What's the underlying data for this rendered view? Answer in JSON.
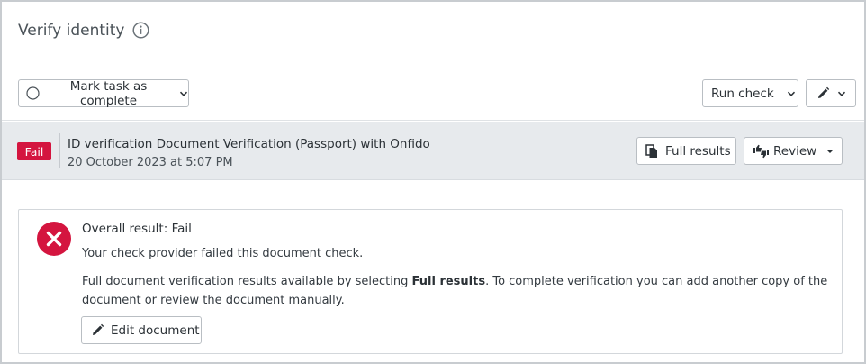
{
  "header": {
    "title": "Verify identity",
    "info_icon": "info-circle-icon"
  },
  "toolbar": {
    "mark_complete_label": "Mark task as complete",
    "run_check_label": "Run check",
    "edit_menu_icon": "pencil-icon"
  },
  "check": {
    "status": "Fail",
    "status_color": "#d4153f",
    "title": "ID verification Document Verification (Passport) with Onfido",
    "date": "20 October 2023 at 5:07 PM",
    "full_results_label": "Full results",
    "review_label": "Review"
  },
  "result": {
    "heading": "Overall result: Fail",
    "message": "Your check provider failed this document check.",
    "detail_prefix": "Full document verification results available by selecting ",
    "detail_bold": "Full results",
    "detail_suffix": ". To complete verification you can add another copy of the document or review the document manually.",
    "edit_document_label": "Edit document",
    "icon": "fail-x-circle-icon",
    "icon_color": "#d4153f"
  }
}
